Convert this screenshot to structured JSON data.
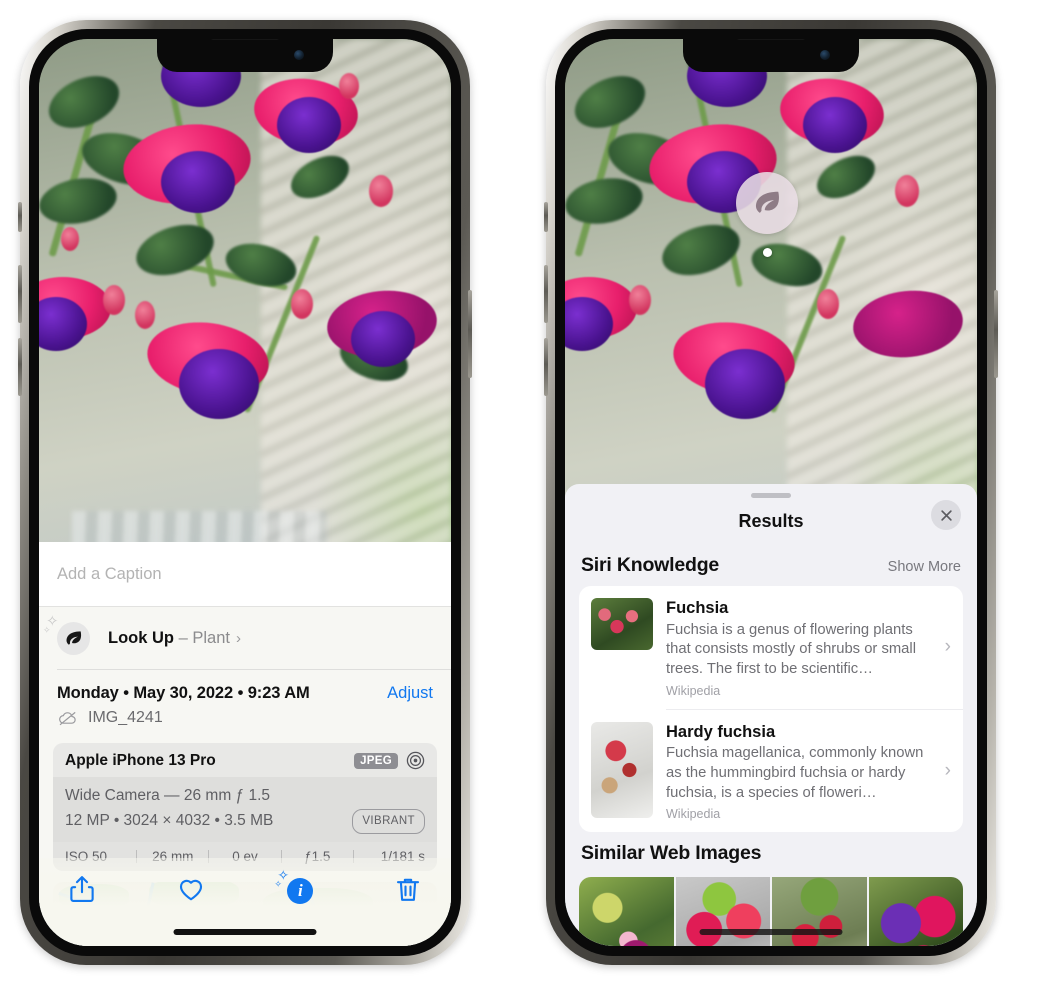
{
  "left_phone": {
    "caption": {
      "placeholder": "Add a Caption",
      "value": ""
    },
    "lookup": {
      "label": "Look Up",
      "dash": "–",
      "subject": "Plant",
      "chevron": "›",
      "icon": "leaf-icon"
    },
    "meta": {
      "date": "Monday • May 30, 2022 • 9:23 AM",
      "adjust_label": "Adjust",
      "filename": "IMG_4241",
      "cloud_icon": "cloud-slash-icon"
    },
    "camera_card": {
      "device": "Apple iPhone 13 Pro",
      "format_badge": "JPEG",
      "aperture_icon": "aperture-icon",
      "lens_line": "Wide Camera — 26 mm ƒ 1.5",
      "specs_line": "12 MP • 3024 × 4032 • 3.5 MB",
      "style_badge": "VIBRANT",
      "exif": [
        "ISO 50",
        "26 mm",
        "0 ev",
        "ƒ1.5",
        "1/181 s"
      ]
    },
    "toolbar": [
      {
        "name": "share-button",
        "icon": "share-icon"
      },
      {
        "name": "favorite-button",
        "icon": "heart-icon"
      },
      {
        "name": "info-button",
        "icon": "info-sparkle-icon"
      },
      {
        "name": "delete-button",
        "icon": "trash-icon"
      }
    ]
  },
  "right_phone": {
    "photo_badge": {
      "icon": "leaf-icon"
    },
    "sheet": {
      "title": "Results",
      "close_icon": "close-icon"
    },
    "siri_knowledge": {
      "title": "Siri Knowledge",
      "action": "Show More",
      "items": [
        {
          "name": "Fuchsia",
          "description": "Fuchsia is a genus of flowering plants that consists mostly of shrubs or small trees. The first to be scientific…",
          "source": "Wikipedia",
          "chevron": "›"
        },
        {
          "name": "Hardy fuchsia",
          "description": "Fuchsia magellanica, commonly known as the hummingbird fuchsia or hardy fuchsia, is a species of floweri…",
          "source": "Wikipedia",
          "chevron": "›"
        }
      ]
    },
    "similar_web_images": {
      "title": "Similar Web Images",
      "count": 4
    }
  },
  "colors": {
    "accent_blue": "#1178f0",
    "sheet_bg": "#f1f1f5",
    "card_bg": "#ffffff",
    "secondary_text": "#6f6f74",
    "badge_gray": "#8e8e93"
  }
}
